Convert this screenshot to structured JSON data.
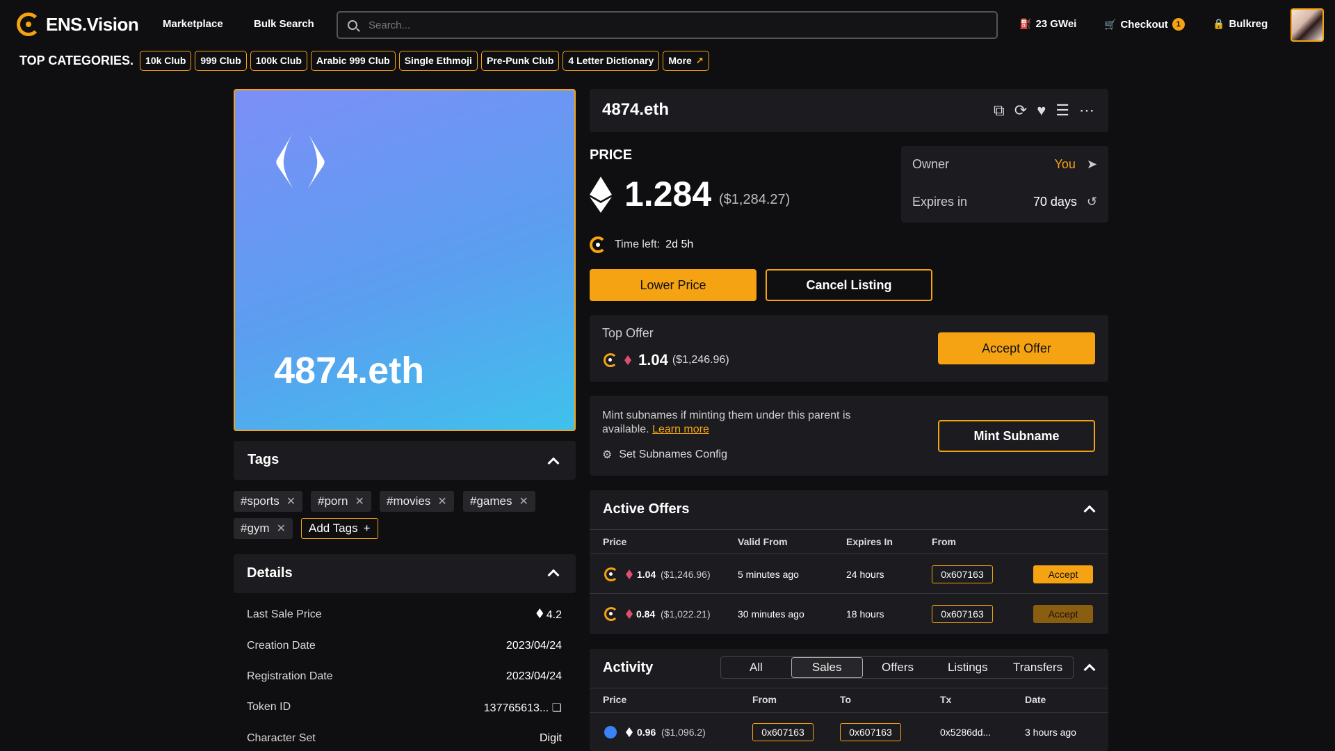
{
  "header": {
    "brand": "ENS.Vision",
    "nav": [
      "Marketplace",
      "Bulk Search"
    ],
    "search_placeholder": "Search...",
    "gas": "23 GWei",
    "checkout": "Checkout",
    "checkout_count": "1",
    "bulkreg": "Bulkreg"
  },
  "categories": {
    "title": "TOP CATEGORIES.",
    "items": [
      "10k Club",
      "999 Club",
      "100k Club",
      "Arabic 999 Club",
      "Single Ethmoji",
      "Pre-Punk Club",
      "4 Letter Dictionary"
    ],
    "more": "More"
  },
  "card": {
    "name": "4874.eth"
  },
  "tags": {
    "title": "Tags",
    "items": [
      "#sports",
      "#porn",
      "#movies",
      "#games",
      "#gym"
    ],
    "add_label": "Add Tags"
  },
  "details": {
    "title": "Details",
    "rows": [
      {
        "label": "Last Sale Price",
        "value": "4.2"
      },
      {
        "label": "Creation Date",
        "value": "2023/04/24"
      },
      {
        "label": "Registration Date",
        "value": "2023/04/24"
      },
      {
        "label": "Token ID",
        "value": "137765613..."
      },
      {
        "label": "Character Set",
        "value": "Digit"
      }
    ]
  },
  "domain": {
    "name": "4874.eth",
    "price_label": "PRICE",
    "price": "1.284",
    "price_usd": "($1,284.27)",
    "owner_label": "Owner",
    "owner_value": "You",
    "expires_label": "Expires in",
    "expires_value": "70 days",
    "time_left_label": "Time left:",
    "time_left_value": "2d 5h",
    "lower_price": "Lower Price",
    "cancel_listing": "Cancel Listing"
  },
  "top_offer": {
    "label": "Top Offer",
    "price": "1.04",
    "usd": "($1,246.96)",
    "accept": "Accept Offer"
  },
  "mint": {
    "text": "Mint subnames if minting them under this parent is available.",
    "learn_more": "Learn more",
    "config": "Set Subnames Config",
    "button": "Mint Subname"
  },
  "active_offers": {
    "title": "Active Offers",
    "columns": [
      "Price",
      "Valid From",
      "Expires In",
      "From"
    ],
    "rows": [
      {
        "price": "1.04",
        "usd": "($1,246.96)",
        "valid_from": "5 minutes ago",
        "expires_in": "24 hours",
        "from": "0x607163",
        "action": "Accept"
      },
      {
        "price": "0.84",
        "usd": "($1,022.21)",
        "valid_from": "30 minutes ago",
        "expires_in": "18 hours",
        "from": "0x607163",
        "action": "Accept"
      }
    ]
  },
  "activity": {
    "title": "Activity",
    "tabs": [
      "All",
      "Sales",
      "Offers",
      "Listings",
      "Transfers"
    ],
    "active_tab": "Sales",
    "columns": [
      "Price",
      "From",
      "To",
      "Tx",
      "Date"
    ],
    "rows": [
      {
        "price": "0.96",
        "usd": "($1,096.2)",
        "from": "0x607163",
        "to": "0x607163",
        "tx": "0x5286dd...",
        "date": "3 hours ago"
      }
    ]
  },
  "colors": {
    "accent": "#f5a312",
    "panel": "#1c1c20",
    "background": "#0f0f11"
  }
}
